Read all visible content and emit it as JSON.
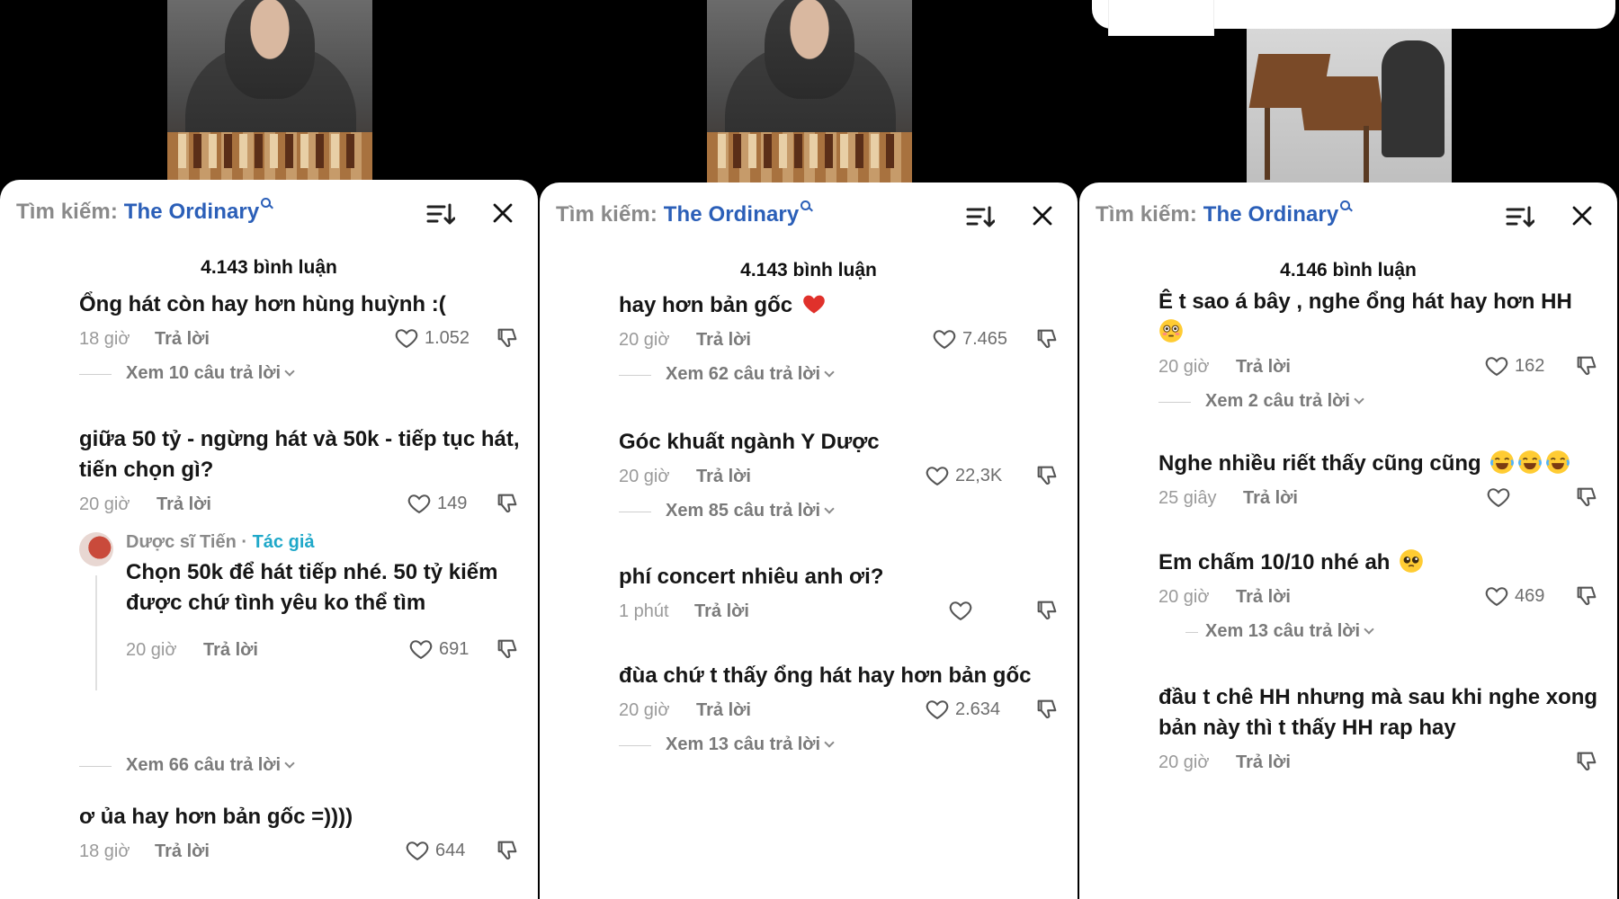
{
  "panels": [
    {
      "search_prefix": "Tìm kiếm:",
      "search_term": "The Ordinary",
      "comment_count": "4.143 bình luận",
      "comments": [
        {
          "text": "Ổng hát còn hay hơn hùng huỳnh :(",
          "time": "18 giờ",
          "reply": "Trả lời",
          "likes": "1.052",
          "view_replies": "Xem 10 câu trả lời"
        },
        {
          "text": "giữa 50 tỷ - ngừng hát và 50k - tiếp tục hát, tiến chọn gì?",
          "time": "20 giờ",
          "reply": "Trả lời",
          "likes": "149"
        },
        {
          "text": "ơ ủa hay hơn bản gốc =))))",
          "time": "18 giờ",
          "reply": "Trả lời",
          "likes": "644"
        }
      ],
      "author_reply": {
        "name": "Dược sĩ Tiến",
        "separator": " · ",
        "badge": "Tác giả",
        "text": "Chọn 50k để hát tiếp nhé. 50 tỷ kiếm được chứ tình yêu ko thể tìm",
        "time": "20 giờ",
        "reply": "Trả lời",
        "likes": "691",
        "view_replies": "Xem 66 câu trả lời"
      }
    },
    {
      "search_prefix": "Tìm kiếm:",
      "search_term": "The Ordinary",
      "comment_count": "4.143 bình luận",
      "comments": [
        {
          "text": "hay hơn bản gốc",
          "time": "20 giờ",
          "reply": "Trả lời",
          "likes": "7.465",
          "view_replies": "Xem 62 câu trả lời"
        },
        {
          "text": "Góc khuất ngành Y Dược",
          "time": "20 giờ",
          "reply": "Trả lời",
          "likes": "22,3K",
          "view_replies": "Xem 85 câu trả lời"
        },
        {
          "text": "phí concert nhiêu anh ơi?",
          "time": "1 phút",
          "reply": "Trả lời",
          "likes": ""
        },
        {
          "text": "đùa chứ t thấy ổng hát hay hơn bản gốc",
          "time": "20 giờ",
          "reply": "Trả lời",
          "likes": "2.634",
          "view_replies": "Xem 13 câu trả lời"
        }
      ]
    },
    {
      "search_prefix": "Tìm kiếm:",
      "search_term": "The Ordinary",
      "comment_count": "4.146 bình luận",
      "comments": [
        {
          "text": "Ê t sao á bây , nghe ổng hát hay hơn HH",
          "time": "20 giờ",
          "reply": "Trả lời",
          "likes": "162",
          "view_replies": "Xem 2 câu trả lời"
        },
        {
          "text": "Nghe nhiều riết thấy cũng cũng",
          "time": "25 giây",
          "reply": "Trả lời",
          "likes": ""
        },
        {
          "text": "Em chấm 10/10 nhé ah",
          "time": "20 giờ",
          "reply": "Trả lời",
          "likes": "469",
          "view_replies": "Xem 13 câu trả lời"
        },
        {
          "text": "đầu t chê HH nhưng mà sau khi nghe xong bản này thì t thấy HH rap hay",
          "time": "20 giờ",
          "reply": "Trả lời",
          "likes": ""
        }
      ]
    }
  ],
  "icons": {
    "sort": "sort-icon",
    "close": "close-icon",
    "like": "heart-outline-icon",
    "dislike": "thumbs-down-icon",
    "heart_emoji": "red-heart-emoji",
    "flushed_emoji": "flushed-face-emoji",
    "laugh_emoji": "tears-of-joy-emoji",
    "pleading_emoji": "pleading-face-emoji"
  },
  "colors": {
    "search_term": "#2b5fb8",
    "author_badge": "#1fa8c9",
    "sheet_bg": "#ffffff",
    "backdrop": "#000000"
  }
}
